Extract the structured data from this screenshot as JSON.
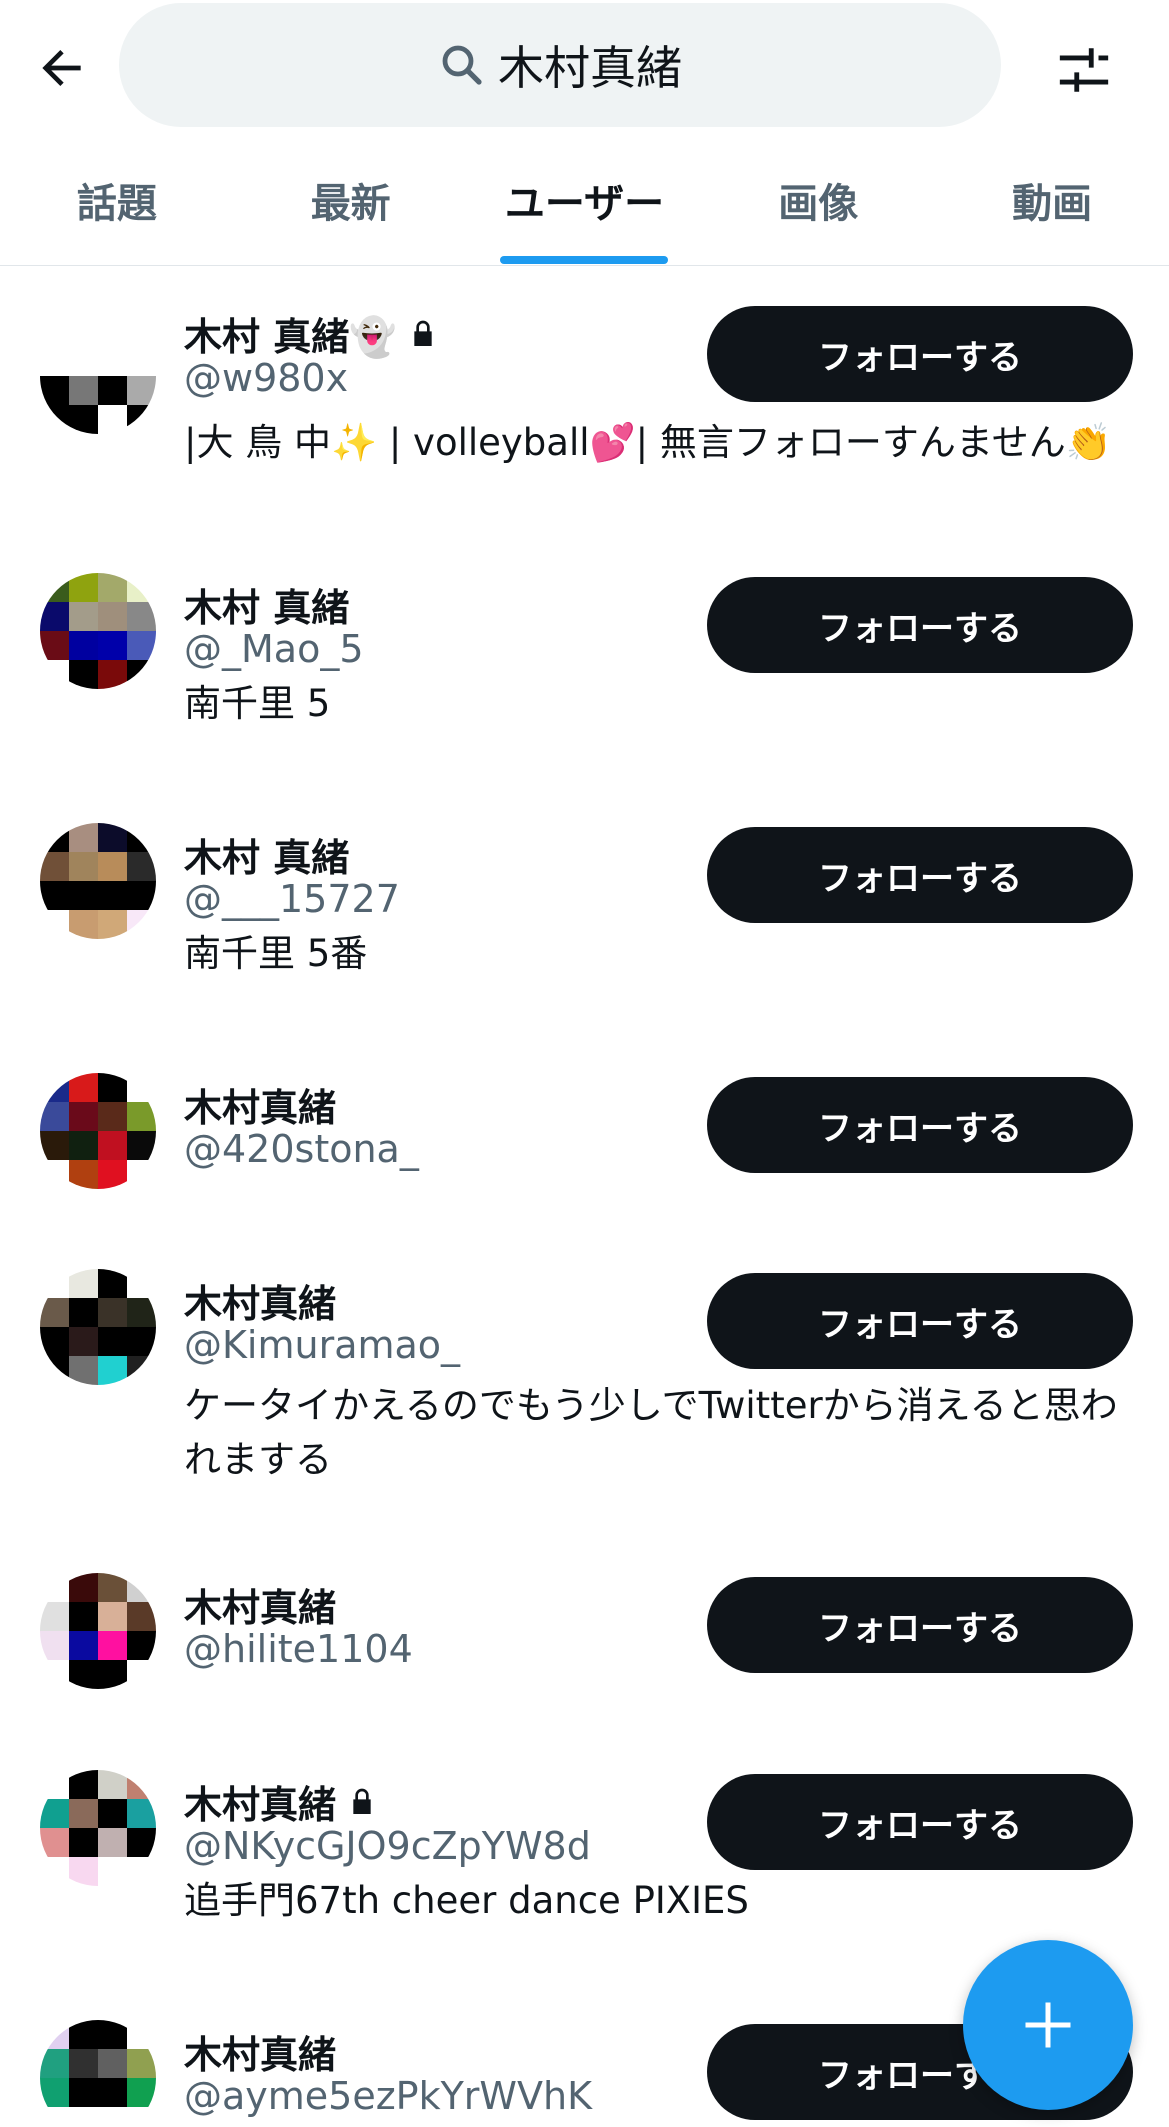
{
  "search": {
    "query": "木村真緒"
  },
  "tabs": [
    {
      "label": "話題"
    },
    {
      "label": "最新"
    },
    {
      "label": "ユーザー"
    },
    {
      "label": "画像"
    },
    {
      "label": "動画"
    }
  ],
  "users": [
    {
      "name": "木村 真緒👻",
      "handle": "@w980x",
      "bio": "|大 鳥 中✨ | volleyball💕| 無言フォローすんません👏",
      "protected": true,
      "follow_label": "フォローする"
    },
    {
      "name": "木村 真緒",
      "handle": "@_Mao_5",
      "bio": "南千里 5",
      "protected": false,
      "follow_label": "フォローする"
    },
    {
      "name": "木村 真緒",
      "handle": "@___15727",
      "bio": "南千里 5番",
      "protected": false,
      "follow_label": "フォローする"
    },
    {
      "name": "木村真緒",
      "handle": "@420stona_",
      "bio": "",
      "protected": false,
      "follow_label": "フォローする"
    },
    {
      "name": "木村真緒",
      "handle": "@Kimuramao_",
      "bio": "ケータイかえるのでもう少しでTwitterから消えると思われまする",
      "protected": false,
      "follow_label": "フォローする"
    },
    {
      "name": "木村真緒",
      "handle": "@hilite1104",
      "bio": "",
      "protected": false,
      "follow_label": "フォローする"
    },
    {
      "name": "木村真緒",
      "handle": "@NKycGJO9cZpYW8d",
      "bio": "追手門67th cheer dance PIXIES",
      "protected": true,
      "follow_label": "フォローする"
    },
    {
      "name": "木村真緒",
      "handle": "@ayme5ezPkYrWVhK",
      "bio": "",
      "protected": false,
      "follow_label": "フォローする"
    }
  ],
  "icons": {
    "back": "arrow-left-icon",
    "search": "search-icon",
    "filter": "sliders-icon",
    "lock": "lock-icon",
    "compose": "plus-icon"
  },
  "colors": {
    "accent": "#1d9bf0",
    "button": "#0f1419",
    "muted": "#536471"
  }
}
